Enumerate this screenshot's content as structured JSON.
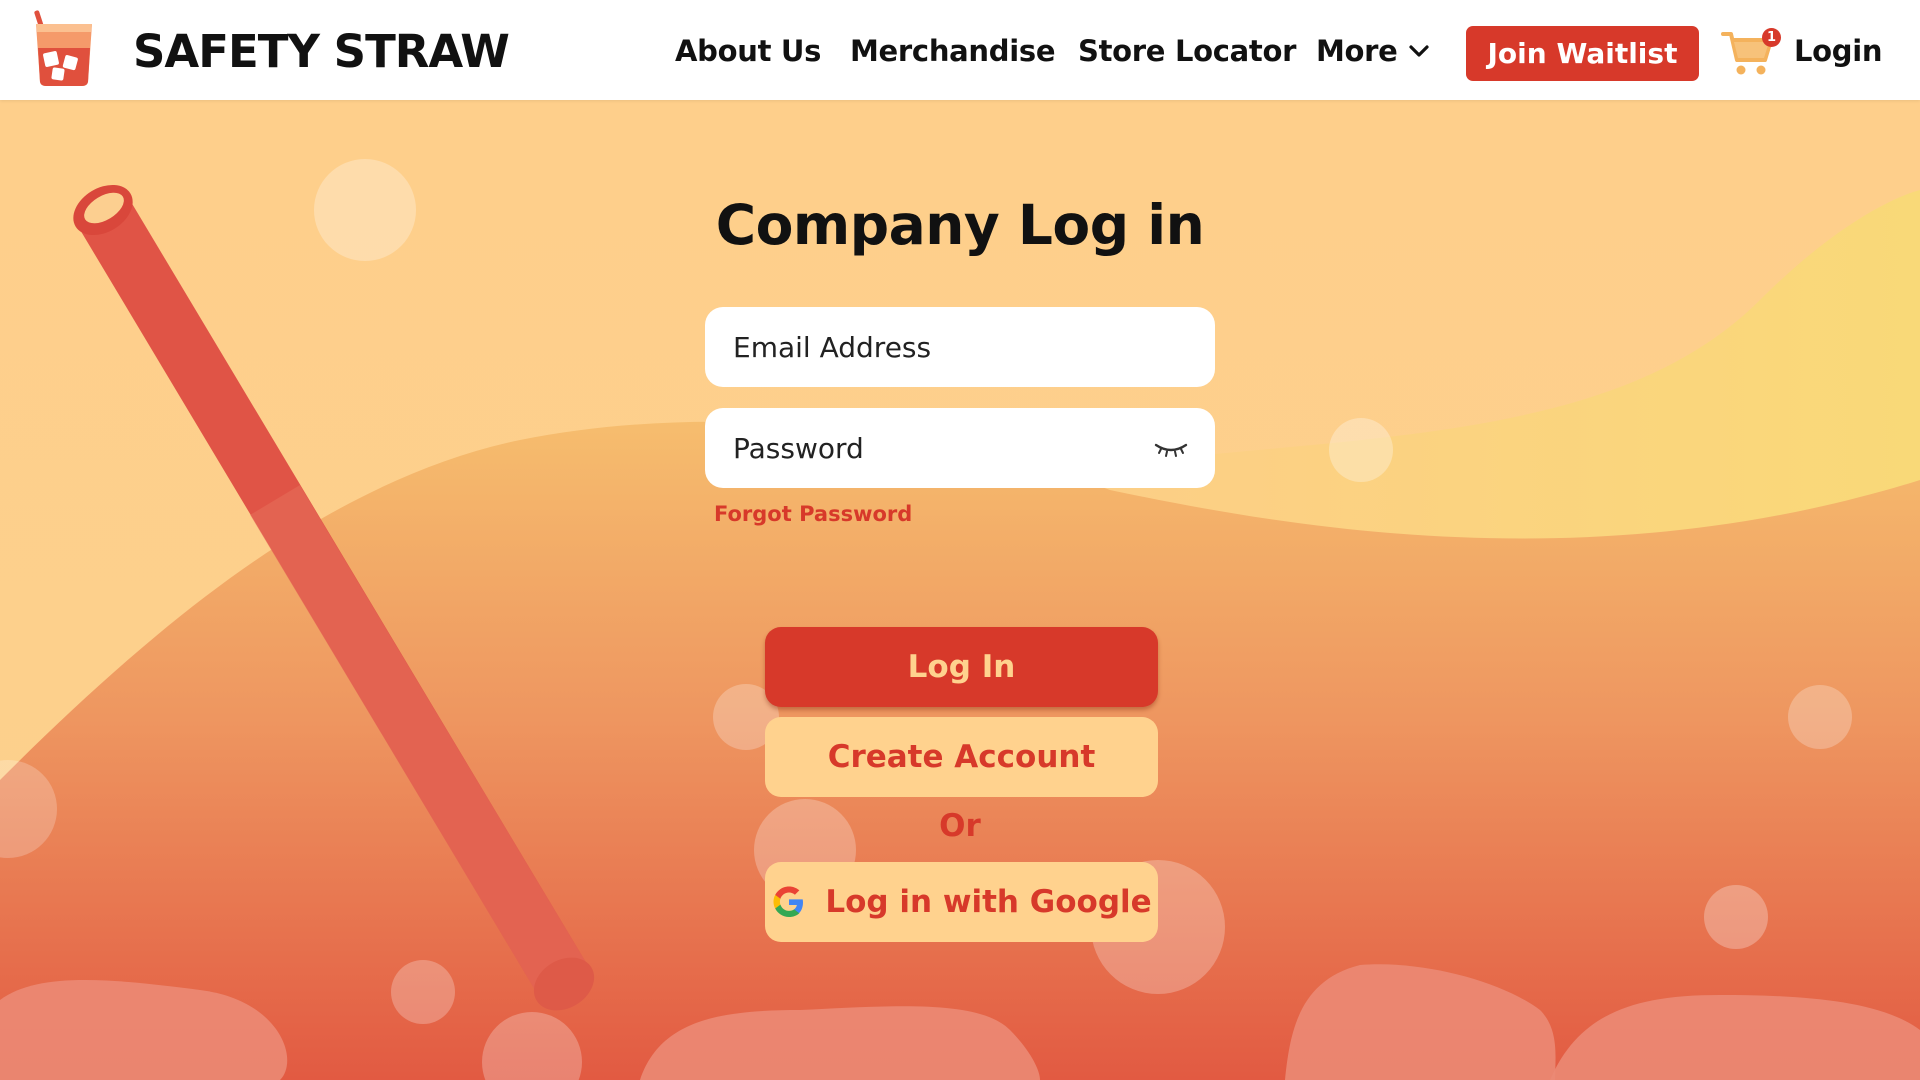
{
  "header": {
    "brand": "SAFETY STRAW",
    "nav": {
      "about": "About Us",
      "merch": "Merchandise",
      "store": "Store Locator",
      "more": "More"
    },
    "join_label": "Join Waitlist",
    "cart_count": "1",
    "login_label": "Login"
  },
  "form": {
    "title": "Company Log in",
    "email_placeholder": "Email Address",
    "email_value": "",
    "password_placeholder": "Password",
    "password_value": "",
    "forgot_label": "Forgot Password",
    "login_button": "Log In",
    "create_button": "Create Account",
    "or_label": "Or",
    "google_button": "Log in with Google"
  },
  "icons": {
    "logo": "safety-straw-cup-icon",
    "more": "chevron-down-icon",
    "cart": "shopping-cart-icon",
    "password_toggle": "eye-closed-icon",
    "google": "google-g-icon"
  },
  "colors": {
    "accent": "#d7392a",
    "button_light": "#ffd28e",
    "bg_top": "#fdcd8a",
    "bg_bottom": "#e35a43",
    "straw": "#e05446"
  }
}
